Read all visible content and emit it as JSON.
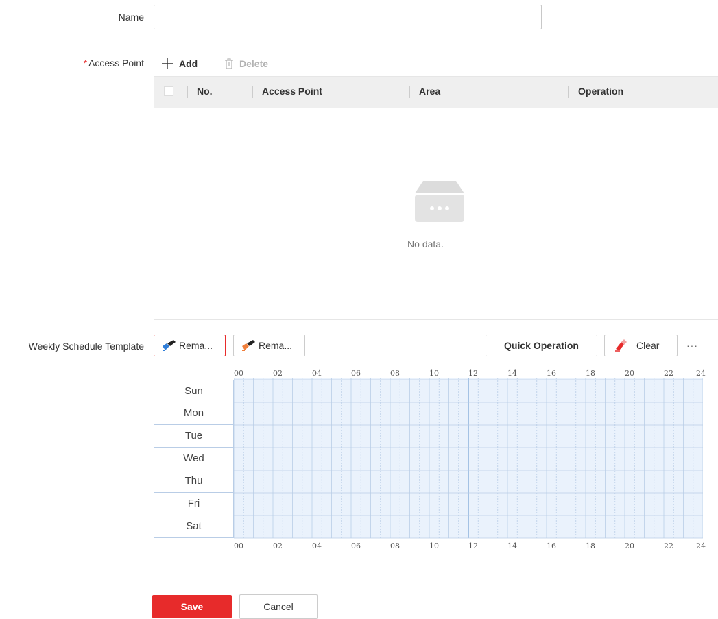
{
  "form": {
    "name_label": "Name",
    "name_value": "",
    "access_point_required_mark": "*",
    "access_point_label": "Access Point",
    "schedule_label": "Weekly Schedule Template"
  },
  "toolbar": {
    "add_label": "Add",
    "delete_label": "Delete",
    "add_icon": "plus-icon",
    "delete_icon": "trash-icon"
  },
  "table": {
    "columns": [
      "No.",
      "Access Point",
      "Area",
      "Operation"
    ],
    "rows": [],
    "empty_text": "No data."
  },
  "schedule": {
    "template_buttons": [
      {
        "label": "Rema...",
        "icon": "brush-blue-icon",
        "color": "#2f7ed8",
        "selected": true
      },
      {
        "label": "Rema...",
        "icon": "brush-orange-icon",
        "color": "#f07f3c",
        "selected": false
      }
    ],
    "quick_operation_label": "Quick Operation",
    "clear_label": "Clear",
    "more_label": "···",
    "hours": [
      "00",
      "02",
      "04",
      "06",
      "08",
      "10",
      "12",
      "14",
      "16",
      "18",
      "20",
      "22",
      "24"
    ],
    "days": [
      "Sun",
      "Mon",
      "Tue",
      "Wed",
      "Thu",
      "Fri",
      "Sat"
    ]
  },
  "actions": {
    "save_label": "Save",
    "cancel_label": "Cancel"
  },
  "colors": {
    "accent": "#e72b2b",
    "grid_fill": "#eaf2fc",
    "grid_line": "#b9cde6"
  }
}
